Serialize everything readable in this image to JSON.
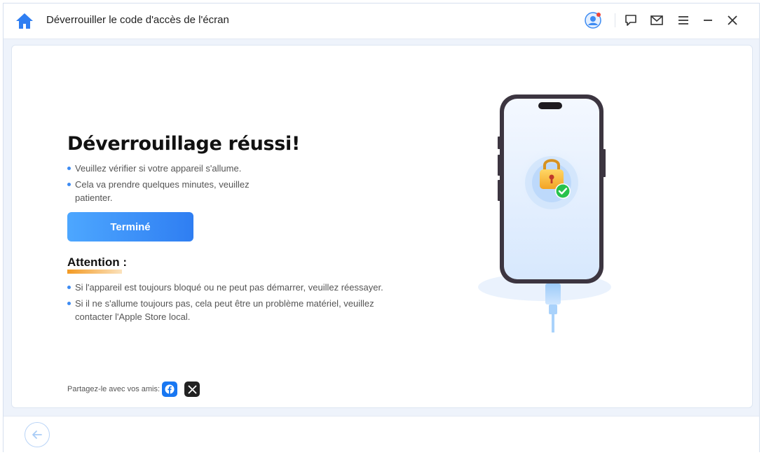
{
  "window": {
    "title": "Déverrouiller le code d'accès de l'écran",
    "icons": [
      "home-icon",
      "user-avatar-icon",
      "feedback-icon",
      "mail-icon",
      "menu-icon",
      "minimize-icon",
      "close-icon"
    ]
  },
  "main": {
    "heading": "Déverrouillage réussi!",
    "bullets": [
      "Veuillez vérifier si votre appareil s'allume.",
      "Cela va prendre quelques minutes, veuillez patienter."
    ],
    "done_button": "Terminé",
    "attention": {
      "title": "Attention :",
      "bullets": [
        "Si l'appareil est toujours bloqué ou ne peut pas démarrer, veuillez réessayer.",
        "Si il ne s'allume toujours pas, cela peut être un problème matériel, veuillez contacter l'Apple Store local."
      ]
    },
    "share": {
      "label": "Partagez-le avec vos amis:",
      "icons": [
        "facebook-icon",
        "x-twitter-icon"
      ]
    }
  },
  "colors": {
    "accent": "#2f7ef2",
    "accent_light": "#4da7ff",
    "attention_underline": "#f39a23",
    "success_green": "#27c24c"
  }
}
